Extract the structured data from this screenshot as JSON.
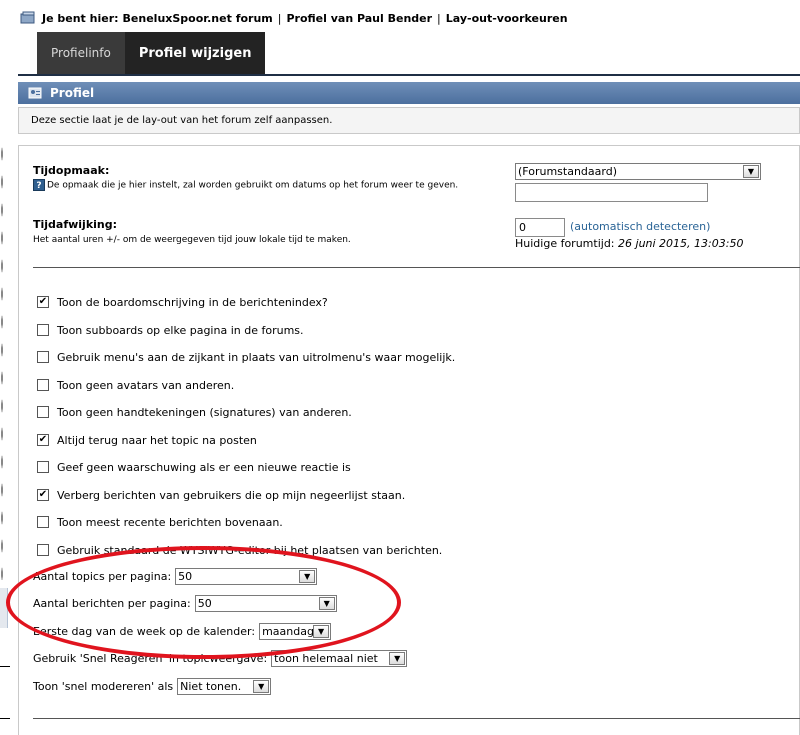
{
  "breadcrumb": {
    "prefix": "Je bent hier:",
    "items": [
      "BeneluxSpoor.net forum",
      "Profiel van Paul Bender",
      "Lay-out-voorkeuren"
    ],
    "separator": "|"
  },
  "tabs": [
    {
      "label": "Profielinfo",
      "active": false
    },
    {
      "label": "Profiel wijzigen",
      "active": true
    }
  ],
  "section": {
    "title": "Profiel",
    "description": "Deze sectie laat je de lay-out van het forum zelf aanpassen."
  },
  "time_format": {
    "label": "Tijdopmaak:",
    "help_symbol": "?",
    "hint": "De opmaak die je hier instelt, zal worden gebruikt om datums op het forum weer te geven.",
    "select_value": "(Forumstandaard)",
    "text_value": ""
  },
  "time_offset": {
    "label": "Tijdafwijking:",
    "hint": "Het aantal uren +/- om de weergegeven tijd jouw lokale tijd te maken.",
    "value": "0",
    "autodetect": "(automatisch detecteren)",
    "current_label": "Huidige forumtijd:",
    "current_value": "26 juni 2015, 13:03:50"
  },
  "options": [
    {
      "label": "Toon de boardomschrijving in de berichtenindex?",
      "checked": true
    },
    {
      "label": "Toon subboards op elke pagina in de forums.",
      "checked": false
    },
    {
      "label": "Gebruik menu's aan de zijkant in plaats van uitrolmenu's waar mogelijk.",
      "checked": false
    },
    {
      "label": "Toon geen avatars van anderen.",
      "checked": false
    },
    {
      "label": "Toon geen handtekeningen (signatures) van anderen.",
      "checked": false
    },
    {
      "label": "Altijd terug naar het topic na posten",
      "checked": true
    },
    {
      "label": "Geef geen waarschuwing als er een nieuwe reactie is",
      "checked": false
    },
    {
      "label": "Verberg berichten van gebruikers die op mijn negeerlijst staan.",
      "checked": true
    },
    {
      "label": "Toon meest recente berichten bovenaan.",
      "checked": false
    },
    {
      "label": "Gebruik standaard de WYSIWYG-editor bij het plaatsen van berichten.",
      "checked": false
    }
  ],
  "selects": {
    "topics": {
      "label": "Aantal topics per pagina:",
      "value": "50"
    },
    "posts": {
      "label": "Aantal berichten per pagina:",
      "value": "50"
    },
    "first_day": {
      "label": "Eerste dag van de week op de kalender:",
      "value": "maandag"
    },
    "quick_reply": {
      "label": "Gebruik 'Snel Reageren' in topicweergave:",
      "value": "toon helemaal niet"
    },
    "quick_mod": {
      "label": "Toon 'snel modereren' als",
      "value": "Niet tonen."
    }
  },
  "icons": {
    "breadcrumb": "forum-icon",
    "section": "profile-icon",
    "dropdown": "chevron-down-icon",
    "help": "help-icon",
    "check": "checkmark-icon"
  },
  "colors": {
    "tab_bar": "#3a3a3a",
    "tab_active": "#232323",
    "header_bar": "#5b7dab",
    "link": "#2a6496",
    "annotation": "#e0141e"
  }
}
